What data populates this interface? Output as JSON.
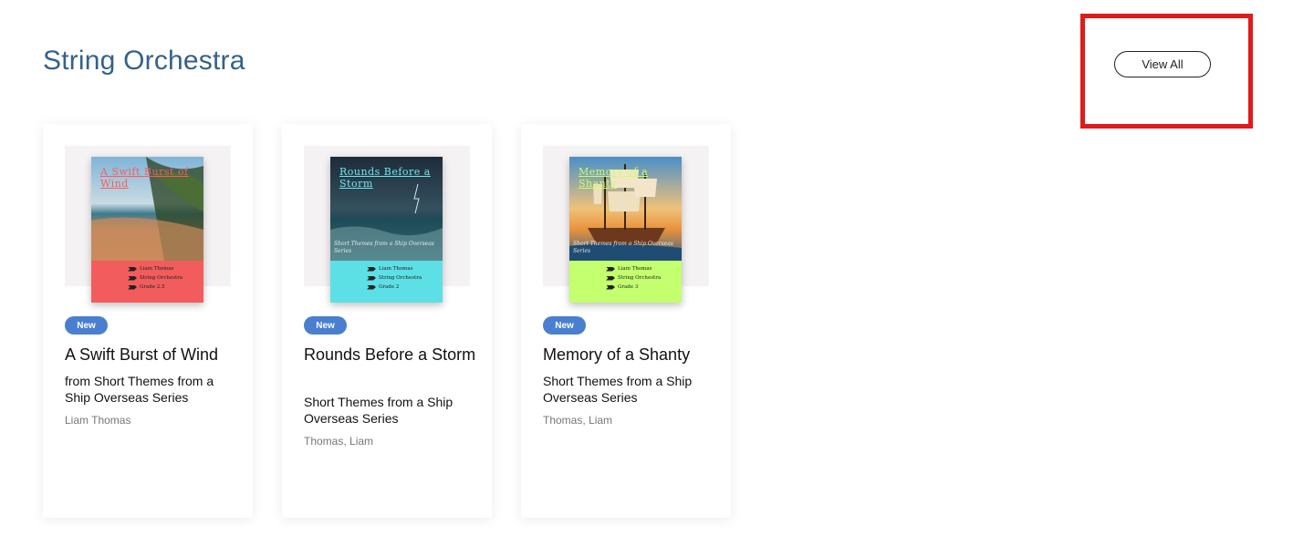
{
  "section": {
    "title": "String Orchestra",
    "view_all_label": "View All"
  },
  "cards": [
    {
      "badge": "New",
      "title": "A Swift Burst of Wind",
      "series": "from Short Themes from a Ship Overseas Series",
      "author": "Liam Thomas",
      "cover": {
        "title": "A Swift Burst of Wind",
        "subtitle": "",
        "composer": "Liam Thomas",
        "ensemble": "String Orchestra",
        "grade": "Grade 2.5",
        "band_color": "#f25c5c",
        "title_color": "#ff5a5a"
      }
    },
    {
      "badge": "New",
      "title": "Rounds Before a Storm",
      "series": "Short Themes from a Ship Overseas Series",
      "author": "Thomas, Liam",
      "cover": {
        "title": "Rounds Before a Storm",
        "subtitle": "Short Themes from a Ship Overseas Series",
        "composer": "Liam Thomas",
        "ensemble": "String Orchestra",
        "grade": "Grade 2",
        "band_color": "#5ce0e6",
        "title_color": "#6ee8ee"
      }
    },
    {
      "badge": "New",
      "title": "Memory of a Shanty",
      "series": "Short Themes from a Ship Overseas Series",
      "author": "Thomas, Liam",
      "cover": {
        "title": "Memory of a Shanty",
        "subtitle": "Short Themes from a Ship Overseas Series",
        "composer": "Liam Thomas",
        "ensemble": "String Orchestra",
        "grade": "Grade 3",
        "band_color": "#c3ff6e",
        "title_color": "#c9ff6a"
      }
    }
  ],
  "colors": {
    "section_title": "#35628a",
    "badge": "#4a7fd0",
    "highlight": "#e01b1b"
  }
}
